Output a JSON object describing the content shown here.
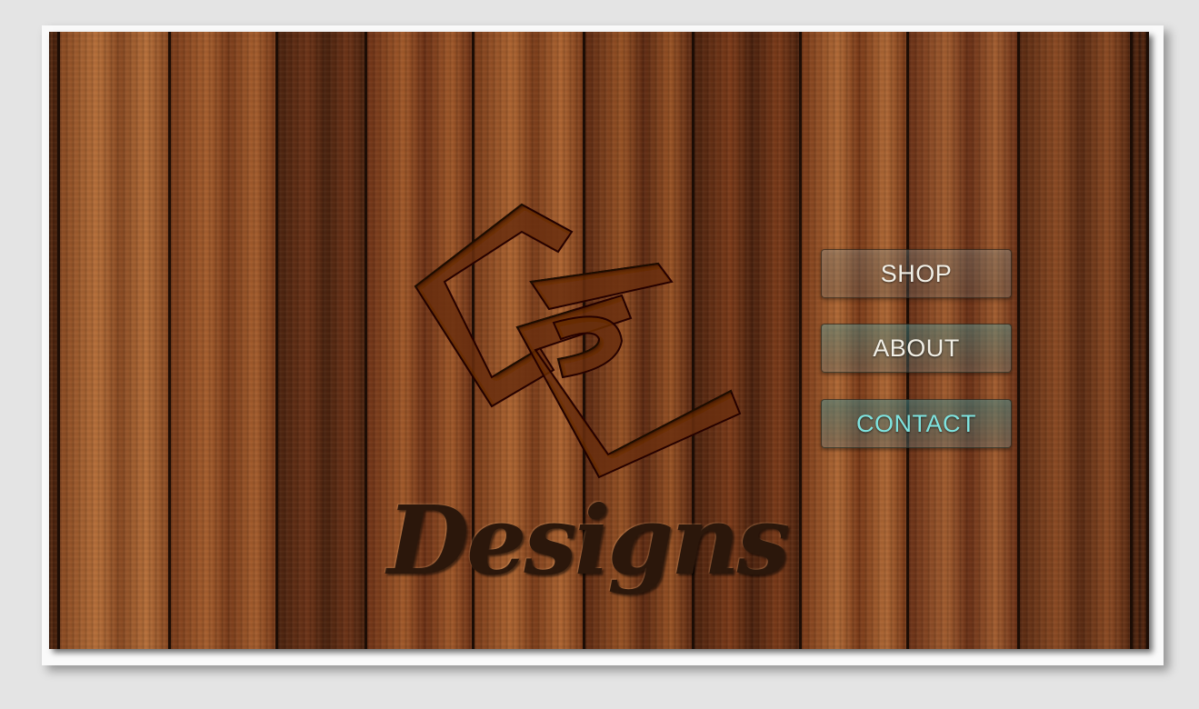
{
  "colors": {
    "page_bg": "#e4e4e4",
    "wood_dark": "#3a1c0c",
    "wood_mid": "#7a3d1a",
    "wood_light": "#b86a33",
    "text_light": "#f1efe6",
    "text_teal": "#7fe3df",
    "designs_text": "#2b170b"
  },
  "logo": {
    "icon": "cl-monogram-logo",
    "wordmark": "Designs"
  },
  "nav": {
    "items": [
      {
        "label": "SHOP",
        "color": "#f1efe6"
      },
      {
        "label": "ABOUT",
        "color": "#f1efe6"
      },
      {
        "label": "CONTACT",
        "color": "#7fe3df"
      }
    ]
  }
}
